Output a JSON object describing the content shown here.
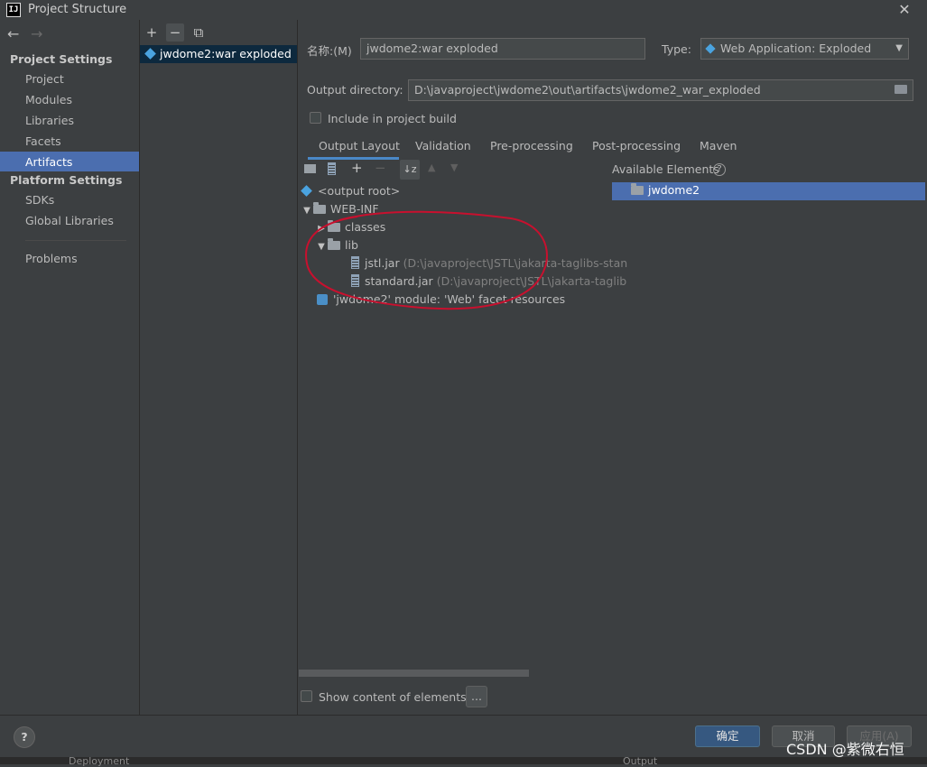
{
  "window": {
    "title": "Project Structure",
    "logo_text": "IJ",
    "close": "✕"
  },
  "nav": {
    "back": "←",
    "forward": "→",
    "project_settings": "Project Settings",
    "items1": [
      "Project",
      "Modules",
      "Libraries",
      "Facets",
      "Artifacts"
    ],
    "platform_settings": "Platform Settings",
    "items2": [
      "SDKs",
      "Global Libraries"
    ],
    "problems": "Problems",
    "selected": "Artifacts"
  },
  "artifacts": {
    "toolbar": [
      "+",
      "−",
      "⧉"
    ],
    "list": [
      "jwdome2:war exploded"
    ]
  },
  "detail": {
    "name_label": "名称:(M)",
    "name_value": "jwdome2:war exploded",
    "type_label": "Type:",
    "type_value": "Web Application: Exploded",
    "output_dir_label": "Output directory:",
    "output_dir_value": "D:\\javaproject\\jwdome2\\out\\artifacts\\jwdome2_war_exploded",
    "include_build": "Include in project build",
    "tabs": [
      "Output Layout",
      "Validation",
      "Pre-processing",
      "Post-processing",
      "Maven"
    ],
    "active_tab": "Output Layout"
  },
  "tree": {
    "output_root": "<output root>",
    "web_inf": "WEB-INF",
    "classes": "classes",
    "lib": "lib",
    "jstl_name": "jstl.jar",
    "jstl_path": "(D:\\javaproject\\JSTL\\jakarta-taglibs-stan",
    "standard_name": "standard.jar",
    "standard_path": "(D:\\javaproject\\JSTL\\jakarta-taglib",
    "facet": "'jwdome2' module: 'Web' facet resources"
  },
  "available": {
    "label": "Available Elements",
    "help": "?",
    "items": [
      "jwdome2"
    ]
  },
  "bottom": {
    "show_content": "Show content of elements",
    "ellipsis": "...",
    "ok": "确定",
    "cancel": "取消",
    "apply": "应用(A)",
    "help": "?",
    "footer_left": "Deployment",
    "footer_right": "Output",
    "watermark": "CSDN @紫微右恒"
  },
  "colors": {
    "accent": "#4b6eaf",
    "annotation": "#c8102e"
  }
}
